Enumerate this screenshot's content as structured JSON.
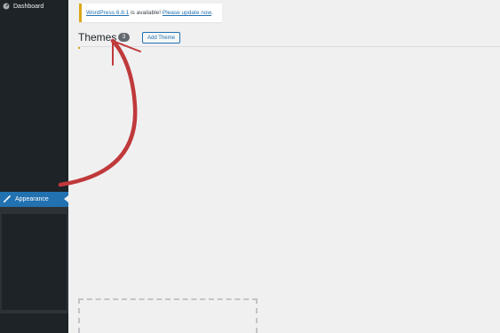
{
  "sidebar": {
    "dashboard_label": "Dashboard",
    "appearance_label": "Appearance"
  },
  "notice": {
    "version_link": "WordPress 6.8.1",
    "middle_text": " is available! ",
    "update_link": "Please update now",
    "end_text": "."
  },
  "header": {
    "title": "Themes",
    "count": "3",
    "add_button_label": "Add Theme"
  },
  "colors": {
    "sidebar_bg": "#1d2327",
    "active_menu": "#2271b1",
    "notice_border": "#dba617",
    "arrow": "#c0393b"
  },
  "icons": {
    "dashboard": "gauge-icon",
    "appearance": "paintbrush-icon"
  }
}
